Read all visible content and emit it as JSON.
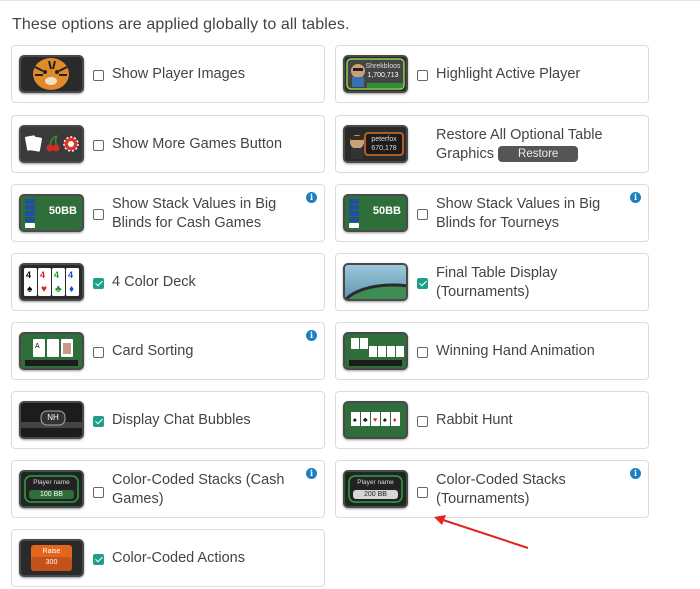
{
  "header": {
    "text": "These options are applied globally to all tables."
  },
  "options": [
    {
      "label": "Show Player Images",
      "checked": false,
      "info": false,
      "thumb": "tiger-avatar"
    },
    {
      "label": "Highlight Active Player",
      "checked": false,
      "info": false,
      "thumb": "active-player",
      "thumb_text": {
        "name": "Shrekbloos",
        "value": "1,700,713"
      }
    },
    {
      "label": "Show More Games Button",
      "checked": false,
      "info": false,
      "thumb": "games-icons"
    },
    {
      "label": "Restore All Optional Table Graphics",
      "checked": null,
      "info": false,
      "thumb": "player-peterfox",
      "button": "Restore",
      "thumb_text": {
        "name": "peterfox",
        "value": "670,178"
      }
    },
    {
      "label": "Show Stack Values in Big Blinds for Cash Games",
      "checked": false,
      "info": true,
      "thumb": "stack-50bb",
      "thumb_text": {
        "value": "50BB"
      }
    },
    {
      "label": "Show Stack Values in Big Blinds for Tourneys",
      "checked": false,
      "info": true,
      "thumb": "stack-50bb",
      "thumb_text": {
        "value": "50BB"
      }
    },
    {
      "label": "4 Color Deck",
      "checked": true,
      "info": false,
      "thumb": "four-color-cards",
      "thumb_text": {
        "value": "4"
      }
    },
    {
      "label": "Final Table Display (Tournaments)",
      "checked": true,
      "info": false,
      "thumb": "final-table"
    },
    {
      "label": "Card Sorting",
      "checked": false,
      "info": true,
      "thumb": "card-sorting"
    },
    {
      "label": "Winning Hand Animation",
      "checked": false,
      "info": false,
      "thumb": "winning-hand"
    },
    {
      "label": "Display Chat Bubbles",
      "checked": true,
      "info": false,
      "thumb": "chat-bubble",
      "thumb_text": {
        "value": "NH"
      }
    },
    {
      "label": "Rabbit Hunt",
      "checked": false,
      "info": false,
      "thumb": "rabbit-hunt"
    },
    {
      "label": "Color-Coded Stacks (Cash Games)",
      "checked": false,
      "info": true,
      "thumb": "color-stack",
      "thumb_text": {
        "name": "Player name",
        "value": "100 BB"
      }
    },
    {
      "label": "Color-Coded Stacks (Tournaments)",
      "checked": false,
      "info": true,
      "thumb": "color-stack-silver",
      "thumb_text": {
        "name": "Player name",
        "value": "200 BB"
      }
    },
    {
      "label": "Color-Coded Actions",
      "checked": true,
      "info": false,
      "thumb": "raise-action",
      "thumb_text": {
        "name": "Raise",
        "value": "300"
      }
    }
  ],
  "colors": {
    "check": "#1e9f88",
    "info": "#1c7fbf",
    "arrow": "#e0261f"
  },
  "icons": {
    "info": "info-icon",
    "arrow": "red-arrow-annotation"
  }
}
